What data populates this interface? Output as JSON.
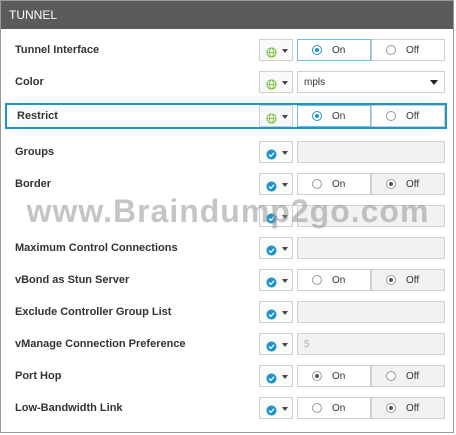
{
  "section_title": "TUNNEL",
  "watermark": "www.Braindump2go.com",
  "colors": {
    "accent": "#1d95c9",
    "header_bg": "#5b5b5b",
    "global_icon": "#7cc242",
    "device_icon": "#1d95c9"
  },
  "option_labels": {
    "on": "On",
    "off": "Off"
  },
  "rows": [
    {
      "label": "Tunnel Interface",
      "scope": "global",
      "control": "radio",
      "value": "On"
    },
    {
      "label": "Color",
      "scope": "global",
      "control": "select",
      "value": "mpls"
    },
    {
      "label": "Restrict",
      "scope": "global",
      "control": "radio",
      "value": "On",
      "highlighted": true
    },
    {
      "label": "Groups",
      "scope": "device",
      "control": "input",
      "value": ""
    },
    {
      "label": "Border",
      "scope": "device",
      "control": "radio",
      "value": "Off"
    },
    {
      "label": "",
      "scope": "device",
      "control": "input",
      "value": "",
      "obscured_by_watermark": true
    },
    {
      "label": "Maximum Control Connections",
      "scope": "device",
      "control": "input",
      "value": ""
    },
    {
      "label": "vBond as Stun Server",
      "scope": "device",
      "control": "radio",
      "value": "Off"
    },
    {
      "label": "Exclude Controller Group List",
      "scope": "device",
      "control": "input",
      "value": ""
    },
    {
      "label": "vManage Connection Preference",
      "scope": "device",
      "control": "input",
      "value": "5"
    },
    {
      "label": "Port Hop",
      "scope": "device",
      "control": "radio",
      "value": "On"
    },
    {
      "label": "Low-Bandwidth Link",
      "scope": "device",
      "control": "radio",
      "value": "Off"
    }
  ]
}
